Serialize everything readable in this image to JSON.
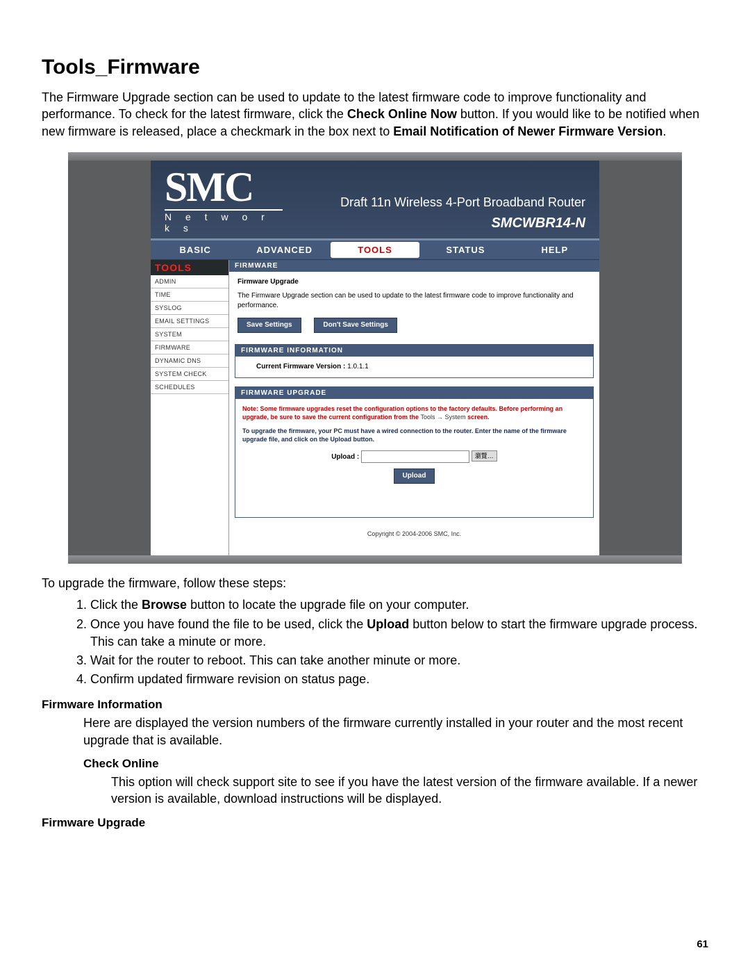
{
  "doc": {
    "title": "Tools_Firmware",
    "intro_p1": "The Firmware Upgrade section can be used to update to the latest firmware code to improve functionality and performance. To check for the latest firmware, click the ",
    "intro_b1": "Check Online Now",
    "intro_p2": " button. If you would like to be notified when new firmware is released, place a checkmark in the box next to ",
    "intro_b2": "Email Notification of Newer Firmware Version",
    "intro_p3": ".",
    "after_ss": "To upgrade the firmware, follow these steps:",
    "steps": {
      "s1a": "Click the ",
      "s1b": "Browse",
      "s1c": " button to locate the upgrade file on your computer.",
      "s2a": "Once you have found the file to be used, click the ",
      "s2b": "Upload",
      "s2c": " button below to start the firmware upgrade process. This can take a minute or more.",
      "s3": "Wait for the router to reboot. This can take another minute or more.",
      "s4": "Confirm updated firmware revision on status page."
    },
    "fw_info_hdr": "Firmware Information",
    "fw_info_body": "Here are displayed the version numbers of the firmware currently installed in your router and the most recent upgrade that is available.",
    "check_online_hdr": "Check Online",
    "check_online_body": "This option will check support site to see if you have the latest version of the firmware available. If a newer version is available, download instructions will be displayed.",
    "fw_upgrade_hdr": "Firmware Upgrade",
    "page_number": "61"
  },
  "ss": {
    "brand_big": "SMC",
    "brand_small": "N e t w o r k s",
    "product": "Draft 11n Wireless 4-Port Broadband Router",
    "model": "SMCWBR14-N",
    "nav": [
      "BASIC",
      "ADVANCED",
      "TOOLS",
      "STATUS",
      "HELP"
    ],
    "nav_active_index": 2,
    "side_title": "TOOLS",
    "side_items": [
      "ADMIN",
      "TIME",
      "SYSLOG",
      "EMAIL SETTINGS",
      "SYSTEM",
      "FIRMWARE",
      "DYNAMIC DNS",
      "SYSTEM CHECK",
      "SCHEDULES"
    ],
    "sec1_hdr": "FIRMWARE",
    "sec1_sub": "Firmware Upgrade",
    "sec1_body": "The Firmware Upgrade section can be used to update to the latest firmware code to improve functionality and performance.",
    "btn_save": "Save Settings",
    "btn_dontsave": "Don't Save Settings",
    "sec2_hdr": "FIRMWARE INFORMATION",
    "sec2_label": "Current Firmware Version :",
    "sec2_value": "1.0.1.1",
    "sec3_hdr": "FIRMWARE UPGRADE",
    "warn_a": "Note: Some firmware upgrades reset the configuration options to the factory defaults. Before performing an upgrade, be sure to save the current configuration from the ",
    "warn_path": "Tools → System",
    "warn_b": " screen.",
    "instr": "To upgrade the firmware, your PC must have a wired connection to the router. Enter the name of the firmware upgrade file, and click on the Upload button.",
    "upload_label": "Upload :",
    "browse_label": "瀏覽…",
    "upload_btn": "Upload",
    "copyright": "Copyright © 2004-2006 SMC, Inc."
  }
}
